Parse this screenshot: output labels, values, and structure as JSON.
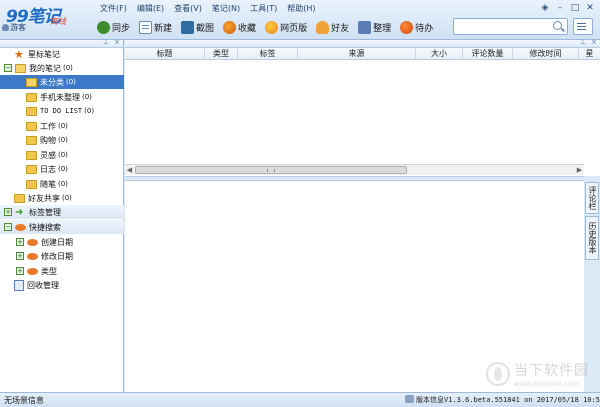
{
  "app": {
    "logo_main": "99笔记",
    "logo_sub": "离线",
    "user_label": "游客"
  },
  "menu": [
    {
      "label": "文件(F)"
    },
    {
      "label": "编辑(E)"
    },
    {
      "label": "查看(V)"
    },
    {
      "label": "笔记(N)"
    },
    {
      "label": "工具(T)"
    },
    {
      "label": "帮助(H)"
    }
  ],
  "toolbar": [
    {
      "label": "同步",
      "icon": "sync-icon"
    },
    {
      "label": "新建",
      "icon": "new-note-icon"
    },
    {
      "label": "截图",
      "icon": "screenshot-icon"
    },
    {
      "label": "收藏",
      "icon": "favorite-icon"
    },
    {
      "label": "网页版",
      "icon": "web-icon"
    },
    {
      "label": "好友",
      "icon": "friend-icon"
    },
    {
      "label": "整理",
      "icon": "organize-icon"
    },
    {
      "label": "待办",
      "icon": "todo-icon"
    }
  ],
  "search": {
    "value": ""
  },
  "tree": [
    {
      "label": "星标笔记",
      "count": ""
    },
    {
      "label": "我的笔记",
      "count": "(0)"
    },
    {
      "label": "未分类",
      "count": "(0)"
    },
    {
      "label": "手机未整理",
      "count": "(0)"
    },
    {
      "label": "TO DO LIST",
      "count": "(0)"
    },
    {
      "label": "工作",
      "count": "(0)"
    },
    {
      "label": "购物",
      "count": "(0)"
    },
    {
      "label": "灵感",
      "count": "(0)"
    },
    {
      "label": "日志",
      "count": "(0)"
    },
    {
      "label": "随笔",
      "count": "(0)"
    },
    {
      "label": "好友共享",
      "count": "(0)"
    },
    {
      "label": "标签管理",
      "count": ""
    },
    {
      "label": "快捷搜索",
      "count": ""
    },
    {
      "label": "创建日期",
      "count": ""
    },
    {
      "label": "修改日期",
      "count": ""
    },
    {
      "label": "类型",
      "count": ""
    },
    {
      "label": "回收管理",
      "count": ""
    }
  ],
  "columns": [
    {
      "label": "标题"
    },
    {
      "label": "类型"
    },
    {
      "label": "标签"
    },
    {
      "label": "来源"
    },
    {
      "label": "大小"
    },
    {
      "label": "评论数量"
    },
    {
      "label": "修改时间"
    },
    {
      "label": "星"
    }
  ],
  "side_tabs": [
    {
      "label": "评论栏"
    },
    {
      "label": "历史版本"
    }
  ],
  "watermark": {
    "cn": "当下软件园",
    "en": "www.downxia.com"
  },
  "status": {
    "left": "无场景信息",
    "right": "版本信息V1.3.6.beta.551841 on 2017/05/18 10:58:03"
  },
  "colors": {
    "selected_row": "#3c7ac8",
    "accent": "#1f6cc5"
  }
}
